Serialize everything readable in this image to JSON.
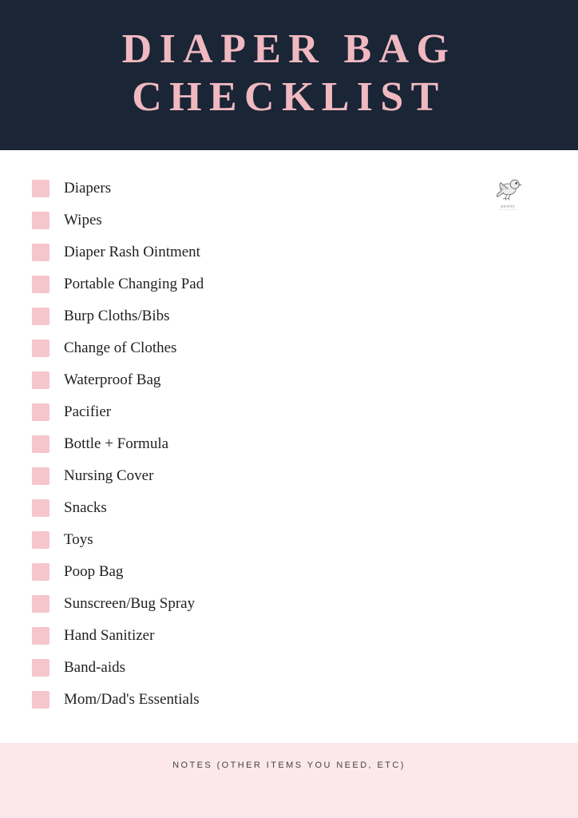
{
  "header": {
    "line1": "DIAPER BAG",
    "line2": "CHECKLIST"
  },
  "checklist": {
    "items": [
      "Diapers",
      "Wipes",
      "Diaper Rash Ointment",
      "Portable Changing Pad",
      "Burp Cloths/Bibs",
      "Change of Clothes",
      "Waterproof Bag",
      "Pacifier",
      "Bottle + Formula",
      "Nursing Cover",
      "Snacks",
      "Toys",
      "Poop Bag",
      "Sunscreen/Bug Spray",
      "Hand Sanitizer",
      "Band-aids",
      "Mom/Dad's Essentials"
    ]
  },
  "notes": {
    "title": "NOTES (OTHER ITEMS YOU NEED, ETC)"
  },
  "logo": {
    "alt": "Paisley and Sparrow logo"
  }
}
